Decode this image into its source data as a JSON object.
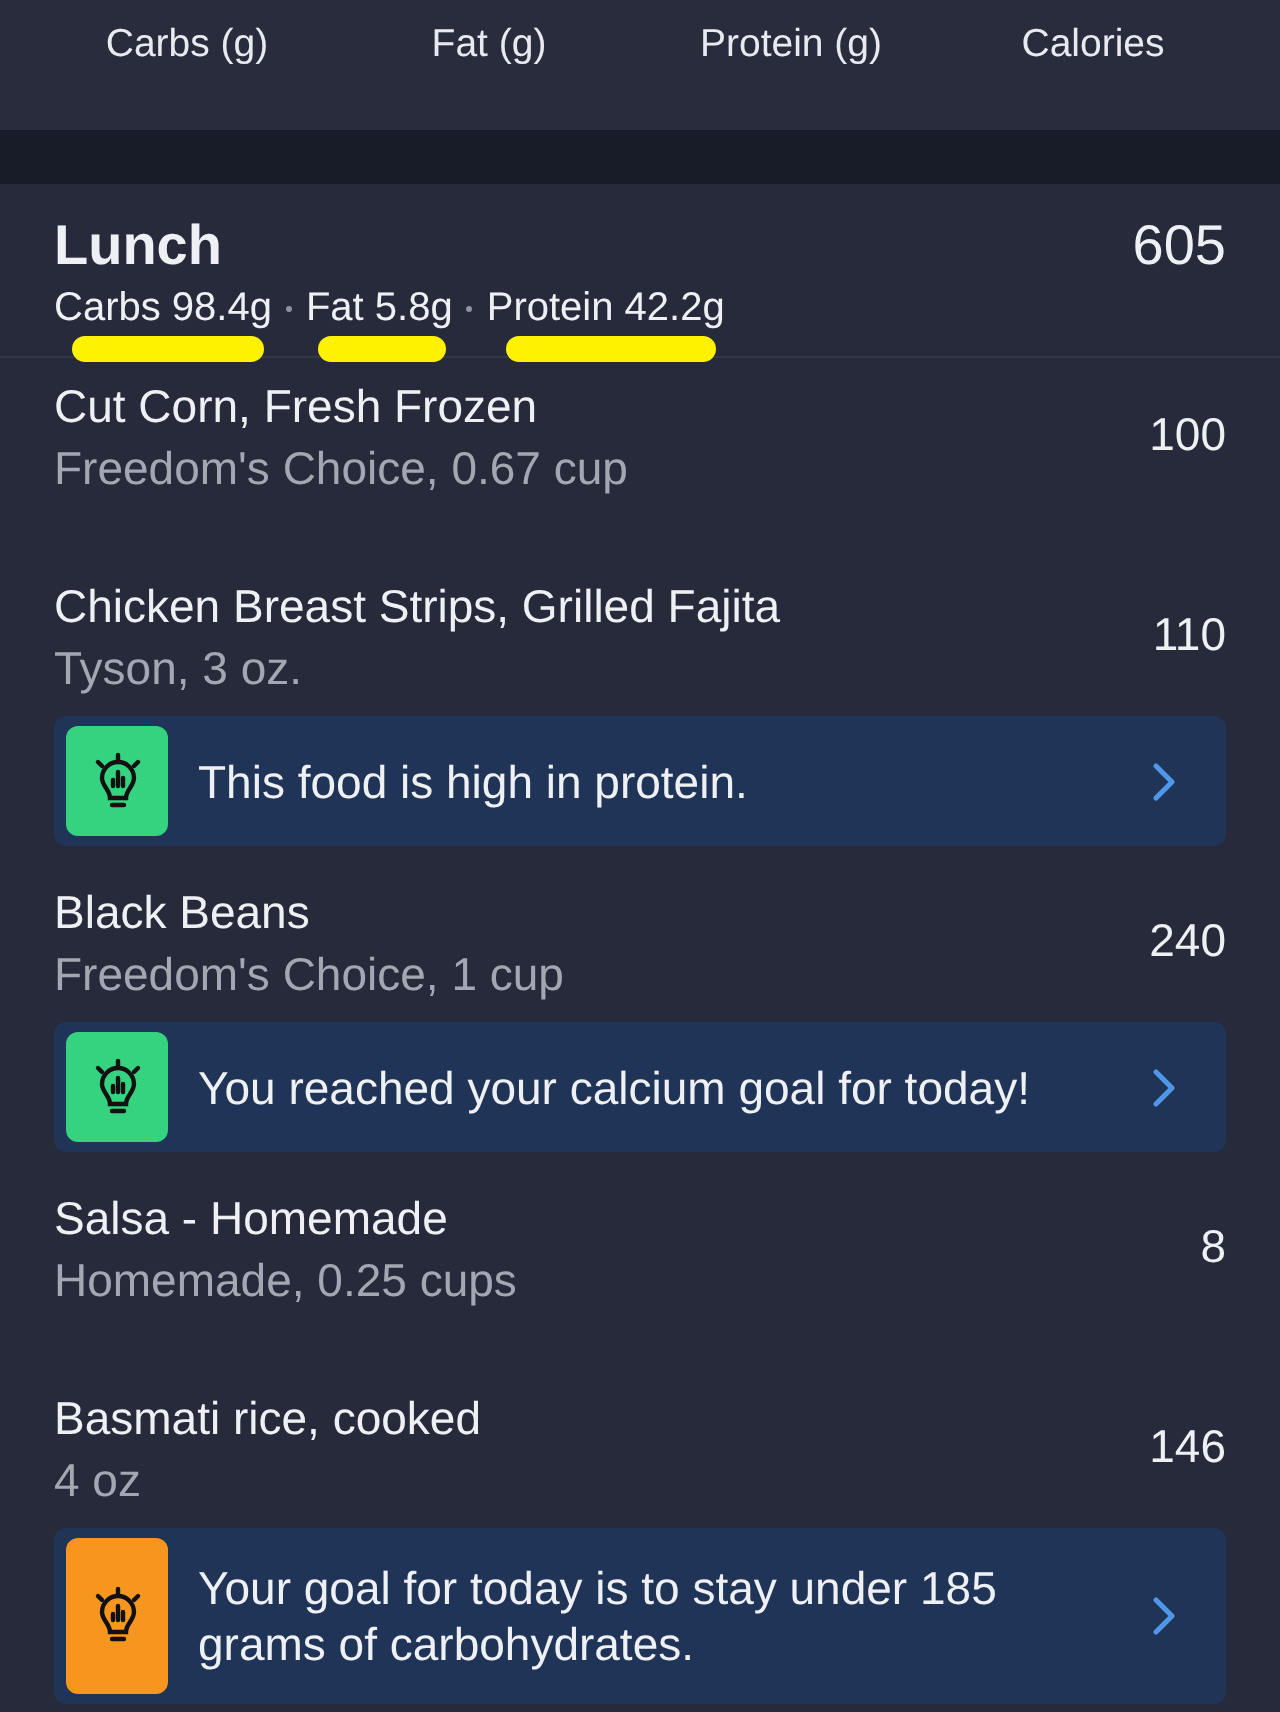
{
  "header": {
    "columns": [
      "Carbs (g)",
      "Fat (g)",
      "Protein (g)",
      "Calories"
    ]
  },
  "meal": {
    "title": "Lunch",
    "calories": "605",
    "macros": [
      {
        "text": "Carbs 98.4g",
        "highlighted": true
      },
      {
        "text": "Fat 5.8g",
        "highlighted": true
      },
      {
        "text": "Protein 42.2g",
        "highlighted": true
      }
    ]
  },
  "entries": [
    {
      "kind": "food",
      "name": "Cut Corn, Fresh Frozen",
      "detail": "Freedom's Choice, 0.67 cup",
      "calories": "100"
    },
    {
      "kind": "food",
      "name": "Chicken Breast Strips, Grilled Fajita",
      "detail": "Tyson, 3 oz.",
      "calories": "110"
    },
    {
      "kind": "tip",
      "text": "This food is high in protein.",
      "color": "#35d37f"
    },
    {
      "kind": "food",
      "name": "Black Beans",
      "detail": "Freedom's Choice, 1 cup",
      "calories": "240"
    },
    {
      "kind": "tip",
      "text": "You reached your calcium goal for today!",
      "color": "#35d37f"
    },
    {
      "kind": "food",
      "name": "Salsa - Homemade",
      "detail": "Homemade, 0.25 cups",
      "calories": "8"
    },
    {
      "kind": "food",
      "name": "Basmati rice, cooked",
      "detail": "4 oz",
      "calories": "146"
    },
    {
      "kind": "tip",
      "text": "Your goal for today is to stay under 185 grams of carbohydrates.",
      "color": "#f7961f"
    }
  ]
}
